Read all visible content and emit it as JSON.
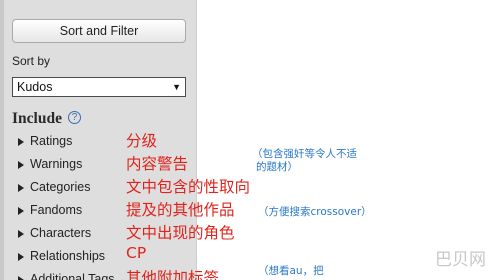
{
  "sidebar": {
    "sort_filter_label": "Sort and Filter",
    "sort_by_label": "Sort by",
    "sort_by_value": "Kudos",
    "include_label": "Include",
    "help_symbol": "?",
    "filters": [
      {
        "label": "Ratings",
        "icon": "triangle-right-icon"
      },
      {
        "label": "Warnings",
        "icon": "triangle-right-icon"
      },
      {
        "label": "Categories",
        "icon": "triangle-right-icon"
      },
      {
        "label": "Fandoms",
        "icon": "triangle-right-icon"
      },
      {
        "label": "Characters",
        "icon": "triangle-right-icon"
      },
      {
        "label": "Relationships",
        "icon": "triangle-right-icon"
      },
      {
        "label": "Additional Tags",
        "icon": "triangle-right-icon"
      }
    ]
  },
  "annotations": {
    "ratings": "分级",
    "warnings": "内容警告",
    "warnings_note_line1": "（包含强奸等令人不适",
    "warnings_note_line2": "的题材）",
    "categories": "文中包含的性取向",
    "fandoms": "提及的其他作品",
    "fandoms_note": "（方便搜索crossover）",
    "characters": "文中出现的角色",
    "relationships": "CP",
    "additional_tags": "其他附加标签",
    "additional_tags_note": "（想看au，把"
  },
  "watermark": "巴贝网",
  "colors": {
    "sidebar_bg": "#dedede",
    "annotation_red": "#e0241c",
    "annotation_blue": "#2a78c9",
    "help_icon_blue": "#3a6db3"
  }
}
